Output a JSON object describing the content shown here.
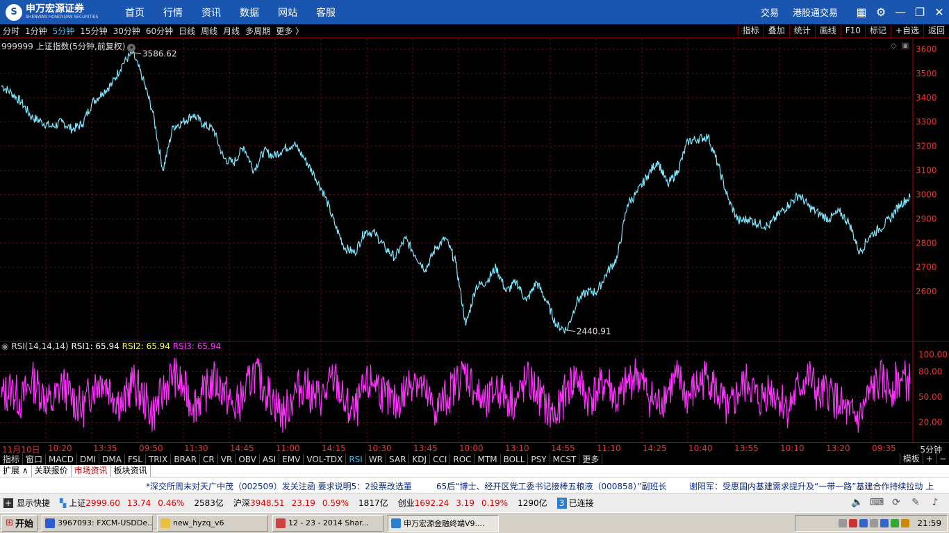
{
  "brand": {
    "logo_glyph": "S",
    "name": "申万宏源证券",
    "name_en": "SHENWAN HONGYUAN SECURITIES"
  },
  "main_nav": [
    "首页",
    "行情",
    "资讯",
    "数据",
    "网站",
    "客服"
  ],
  "right_nav": {
    "trade": "交易",
    "hk_trade": "港股通交易"
  },
  "periods": [
    {
      "label": "分时",
      "active": false
    },
    {
      "label": "1分钟",
      "active": false
    },
    {
      "label": "5分钟",
      "active": true
    },
    {
      "label": "15分钟",
      "active": false
    },
    {
      "label": "30分钟",
      "active": false
    },
    {
      "label": "60分钟",
      "active": false
    },
    {
      "label": "日线",
      "active": false
    },
    {
      "label": "周线",
      "active": false
    },
    {
      "label": "月线",
      "active": false
    },
    {
      "label": "多周期",
      "active": false
    },
    {
      "label": "更多 〉",
      "active": false
    }
  ],
  "tool_buttons": [
    "指标",
    "叠加",
    "统计",
    "画线",
    "F10",
    "标记",
    "+自选",
    "返回"
  ],
  "stock": {
    "title": "999999 上证指数(5分钟,前复权)"
  },
  "price_axis": [
    "3600",
    "3500",
    "3400",
    "3300",
    "3200",
    "3100",
    "3000",
    "2900",
    "2800",
    "2700",
    "2600"
  ],
  "rsi_axis": [
    "100.00",
    "80.00",
    "50.00",
    "20.00"
  ],
  "rsi_legend": {
    "name": "RSI(14,14,14)",
    "rsi1": "RSI1: 65.94",
    "rsi2": "RSI2: 65.94",
    "rsi3": "RSI3: 65.94"
  },
  "time_axis": [
    "11月10日",
    "10:20",
    "13:35",
    "09:50",
    "11:30",
    "14:45",
    "11:00",
    "14:15",
    "10:30",
    "13:45",
    "10:00",
    "13:10",
    "14:55",
    "11:10",
    "14:25",
    "10:40",
    "13:55",
    "10:10",
    "13:20",
    "09:35"
  ],
  "period_label": "5分钟",
  "indicator_tabs": [
    {
      "label": "指标",
      "active": false
    },
    {
      "label": "窗口",
      "active": false
    },
    {
      "label": "MACD",
      "active": false
    },
    {
      "label": "DMI",
      "active": false
    },
    {
      "label": "DMA",
      "active": false
    },
    {
      "label": "FSL",
      "active": false
    },
    {
      "label": "TRIX",
      "active": false
    },
    {
      "label": "BRAR",
      "active": false
    },
    {
      "label": "CR",
      "active": false
    },
    {
      "label": "VR",
      "active": false
    },
    {
      "label": "OBV",
      "active": false
    },
    {
      "label": "ASI",
      "active": false
    },
    {
      "label": "EMV",
      "active": false
    },
    {
      "label": "VOL-TDX",
      "active": false
    },
    {
      "label": "RSI",
      "active": true
    },
    {
      "label": "WR",
      "active": false
    },
    {
      "label": "SAR",
      "active": false
    },
    {
      "label": "KDJ",
      "active": false
    },
    {
      "label": "CCI",
      "active": false
    },
    {
      "label": "ROC",
      "active": false
    },
    {
      "label": "MTM",
      "active": false
    },
    {
      "label": "BOLL",
      "active": false
    },
    {
      "label": "PSY",
      "active": false
    },
    {
      "label": "MCST",
      "active": false
    },
    {
      "label": "更多",
      "active": false
    }
  ],
  "indicator_right": [
    "模板",
    "+",
    "−"
  ],
  "ext_tabs": [
    {
      "label": "扩展 ∧",
      "active": false
    },
    {
      "label": "关联报价",
      "active": false
    },
    {
      "label": "市场资讯",
      "active": true
    },
    {
      "label": "板块资讯",
      "active": false
    }
  ],
  "news": [
    "*深交所周末对天广中茂（002509）发关注函  要求说明5：2投票改选董",
    "65后“博士、经开区党工委书记接棒五粮液（000858）”副班长",
    "谢阳军：受惠国内基建需求提升及“一带一路”基建合作持续拉动  上"
  ],
  "status": {
    "quick_label": "显示快捷",
    "sh": {
      "name": "上证",
      "value": "2999.60",
      "change": "13.74",
      "pct": "0.46%",
      "amount": "2583亿"
    },
    "sz": {
      "name": "沪深",
      "value": "3948.51",
      "change": "23.19",
      "pct": "0.59%",
      "amount": "1817亿"
    },
    "cy": {
      "name": "创业",
      "value": "1692.24",
      "change": "3.19",
      "pct": "0.19%",
      "amount": "1290亿"
    },
    "conn_count": "3",
    "conn_label": "已连接"
  },
  "taskbar": {
    "start": "开始",
    "tasks": [
      {
        "label": "3967093: FXCM-USDDe...",
        "active": false,
        "color": "#2a5bd0"
      },
      {
        "label": "new_hyzq_v6",
        "active": false,
        "color": "#e8c040"
      },
      {
        "label": "12 - 23 - 2014 Shar...",
        "active": false,
        "color": "#d04040"
      },
      {
        "label": "申万宏源金融终端V9....",
        "active": true,
        "color": "#2a7fd4"
      }
    ],
    "clock": "21:59"
  },
  "chart_data": {
    "type": "line",
    "title": "999999 上证指数(5分钟,前复权)",
    "y_range": [
      2440,
      3600
    ],
    "y_ticks": [
      3600,
      3500,
      3400,
      3300,
      3200,
      3100,
      3000,
      2900,
      2800,
      2700,
      2600
    ],
    "annotations": [
      {
        "label": "3586.62",
        "value": 3586.62,
        "kind": "high"
      },
      {
        "label": "2440.91",
        "value": 2440.91,
        "kind": "low"
      }
    ],
    "series": [
      {
        "color": "#7fe8ff",
        "points": [
          [
            0,
            3450
          ],
          [
            1,
            3420
          ],
          [
            2,
            3380
          ],
          [
            3,
            3320
          ],
          [
            4,
            3300
          ],
          [
            5,
            3280
          ],
          [
            6,
            3300
          ],
          [
            7,
            3270
          ],
          [
            8,
            3290
          ],
          [
            9,
            3380
          ],
          [
            10,
            3420
          ],
          [
            11,
            3460
          ],
          [
            12,
            3540
          ],
          [
            13,
            3586.62
          ],
          [
            14,
            3480
          ],
          [
            15,
            3340
          ],
          [
            16,
            3100
          ],
          [
            17,
            3280
          ],
          [
            18,
            3300
          ],
          [
            19,
            3330
          ],
          [
            20,
            3290
          ],
          [
            21,
            3270
          ],
          [
            22,
            3150
          ],
          [
            23,
            3130
          ],
          [
            24,
            3200
          ],
          [
            25,
            3100
          ],
          [
            26,
            3180
          ],
          [
            27,
            3160
          ],
          [
            28,
            3190
          ],
          [
            29,
            3210
          ],
          [
            30,
            3150
          ],
          [
            31,
            3080
          ],
          [
            32,
            3000
          ],
          [
            33,
            2880
          ],
          [
            34,
            2780
          ],
          [
            35,
            2760
          ],
          [
            36,
            2850
          ],
          [
            37,
            2840
          ],
          [
            38,
            2780
          ],
          [
            39,
            2740
          ],
          [
            40,
            2820
          ],
          [
            41,
            2750
          ],
          [
            42,
            2690
          ],
          [
            43,
            2780
          ],
          [
            44,
            2820
          ],
          [
            45,
            2720
          ],
          [
            46,
            2460
          ],
          [
            47,
            2620
          ],
          [
            48,
            2640
          ],
          [
            49,
            2700
          ],
          [
            50,
            2600
          ],
          [
            51,
            2640
          ],
          [
            52,
            2560
          ],
          [
            53,
            2640
          ],
          [
            54,
            2560
          ],
          [
            55,
            2460
          ],
          [
            56,
            2440.91
          ],
          [
            57,
            2560
          ],
          [
            58,
            2600
          ],
          [
            59,
            2600
          ],
          [
            60,
            2680
          ],
          [
            61,
            2740
          ],
          [
            62,
            2960
          ],
          [
            63,
            3010
          ],
          [
            64,
            3080
          ],
          [
            65,
            3140
          ],
          [
            66,
            3040
          ],
          [
            67,
            3100
          ],
          [
            68,
            3220
          ],
          [
            69,
            3230
          ],
          [
            70,
            3240
          ],
          [
            71,
            3120
          ],
          [
            72,
            2980
          ],
          [
            73,
            2890
          ],
          [
            74,
            2900
          ],
          [
            75,
            2880
          ],
          [
            76,
            2870
          ],
          [
            77,
            2920
          ],
          [
            78,
            2960
          ],
          [
            79,
            3000
          ],
          [
            80,
            2950
          ],
          [
            81,
            2920
          ],
          [
            82,
            2900
          ],
          [
            83,
            2930
          ],
          [
            84,
            2880
          ],
          [
            85,
            2760
          ],
          [
            86,
            2830
          ],
          [
            87,
            2860
          ],
          [
            88,
            2900
          ],
          [
            89,
            2960
          ],
          [
            90,
            2990
          ]
        ]
      }
    ]
  },
  "rsi_data": {
    "type": "line",
    "y_range": [
      0,
      100
    ],
    "y_ticks": [
      100,
      80,
      50,
      20
    ],
    "series": [
      {
        "name": "RSI3",
        "color": "#ff33ff",
        "points": [
          [
            0,
            50
          ],
          [
            1,
            60
          ],
          [
            2,
            45
          ],
          [
            3,
            70
          ],
          [
            4,
            55
          ],
          [
            5,
            40
          ],
          [
            6,
            65
          ],
          [
            7,
            50
          ],
          [
            8,
            35
          ],
          [
            9,
            60
          ],
          [
            10,
            72
          ],
          [
            11,
            55
          ],
          [
            12,
            40
          ],
          [
            13,
            68
          ],
          [
            14,
            50
          ],
          [
            15,
            30
          ],
          [
            16,
            55
          ],
          [
            17,
            78
          ],
          [
            18,
            60
          ],
          [
            19,
            42
          ],
          [
            20,
            52
          ],
          [
            21,
            70
          ],
          [
            22,
            58
          ],
          [
            23,
            36
          ],
          [
            24,
            50
          ],
          [
            25,
            80
          ],
          [
            26,
            62
          ],
          [
            27,
            45
          ],
          [
            28,
            28
          ],
          [
            29,
            55
          ],
          [
            30,
            66
          ],
          [
            31,
            48
          ],
          [
            32,
            52
          ],
          [
            33,
            74
          ],
          [
            34,
            40
          ],
          [
            35,
            30
          ],
          [
            36,
            60
          ],
          [
            37,
            70
          ],
          [
            38,
            50
          ],
          [
            39,
            40
          ],
          [
            40,
            58
          ],
          [
            41,
            76
          ],
          [
            42,
            52
          ],
          [
            43,
            34
          ],
          [
            44,
            48
          ],
          [
            45,
            66
          ],
          [
            46,
            80
          ],
          [
            47,
            55
          ],
          [
            48,
            38
          ],
          [
            49,
            62
          ],
          [
            50,
            50
          ],
          [
            51,
            44
          ],
          [
            52,
            70
          ],
          [
            53,
            58
          ],
          [
            54,
            36
          ],
          [
            55,
            26
          ],
          [
            56,
            60
          ],
          [
            57,
            74
          ],
          [
            58,
            48
          ],
          [
            59,
            56
          ],
          [
            60,
            70
          ],
          [
            61,
            42
          ],
          [
            62,
            66
          ],
          [
            63,
            78
          ],
          [
            64,
            54
          ],
          [
            65,
            40
          ],
          [
            66,
            58
          ],
          [
            67,
            72
          ],
          [
            68,
            48
          ],
          [
            69,
            64
          ],
          [
            70,
            76
          ],
          [
            71,
            52
          ],
          [
            72,
            30
          ],
          [
            73,
            56
          ],
          [
            74,
            68
          ],
          [
            75,
            44
          ],
          [
            76,
            60
          ],
          [
            77,
            50
          ],
          [
            78,
            36
          ],
          [
            79,
            62
          ],
          [
            80,
            74
          ],
          [
            81,
            48
          ],
          [
            82,
            58
          ],
          [
            83,
            40
          ],
          [
            84,
            28
          ],
          [
            85,
            24
          ],
          [
            86,
            54
          ],
          [
            87,
            70
          ],
          [
            88,
            60
          ],
          [
            89,
            72
          ],
          [
            90,
            65.94
          ]
        ]
      }
    ]
  }
}
